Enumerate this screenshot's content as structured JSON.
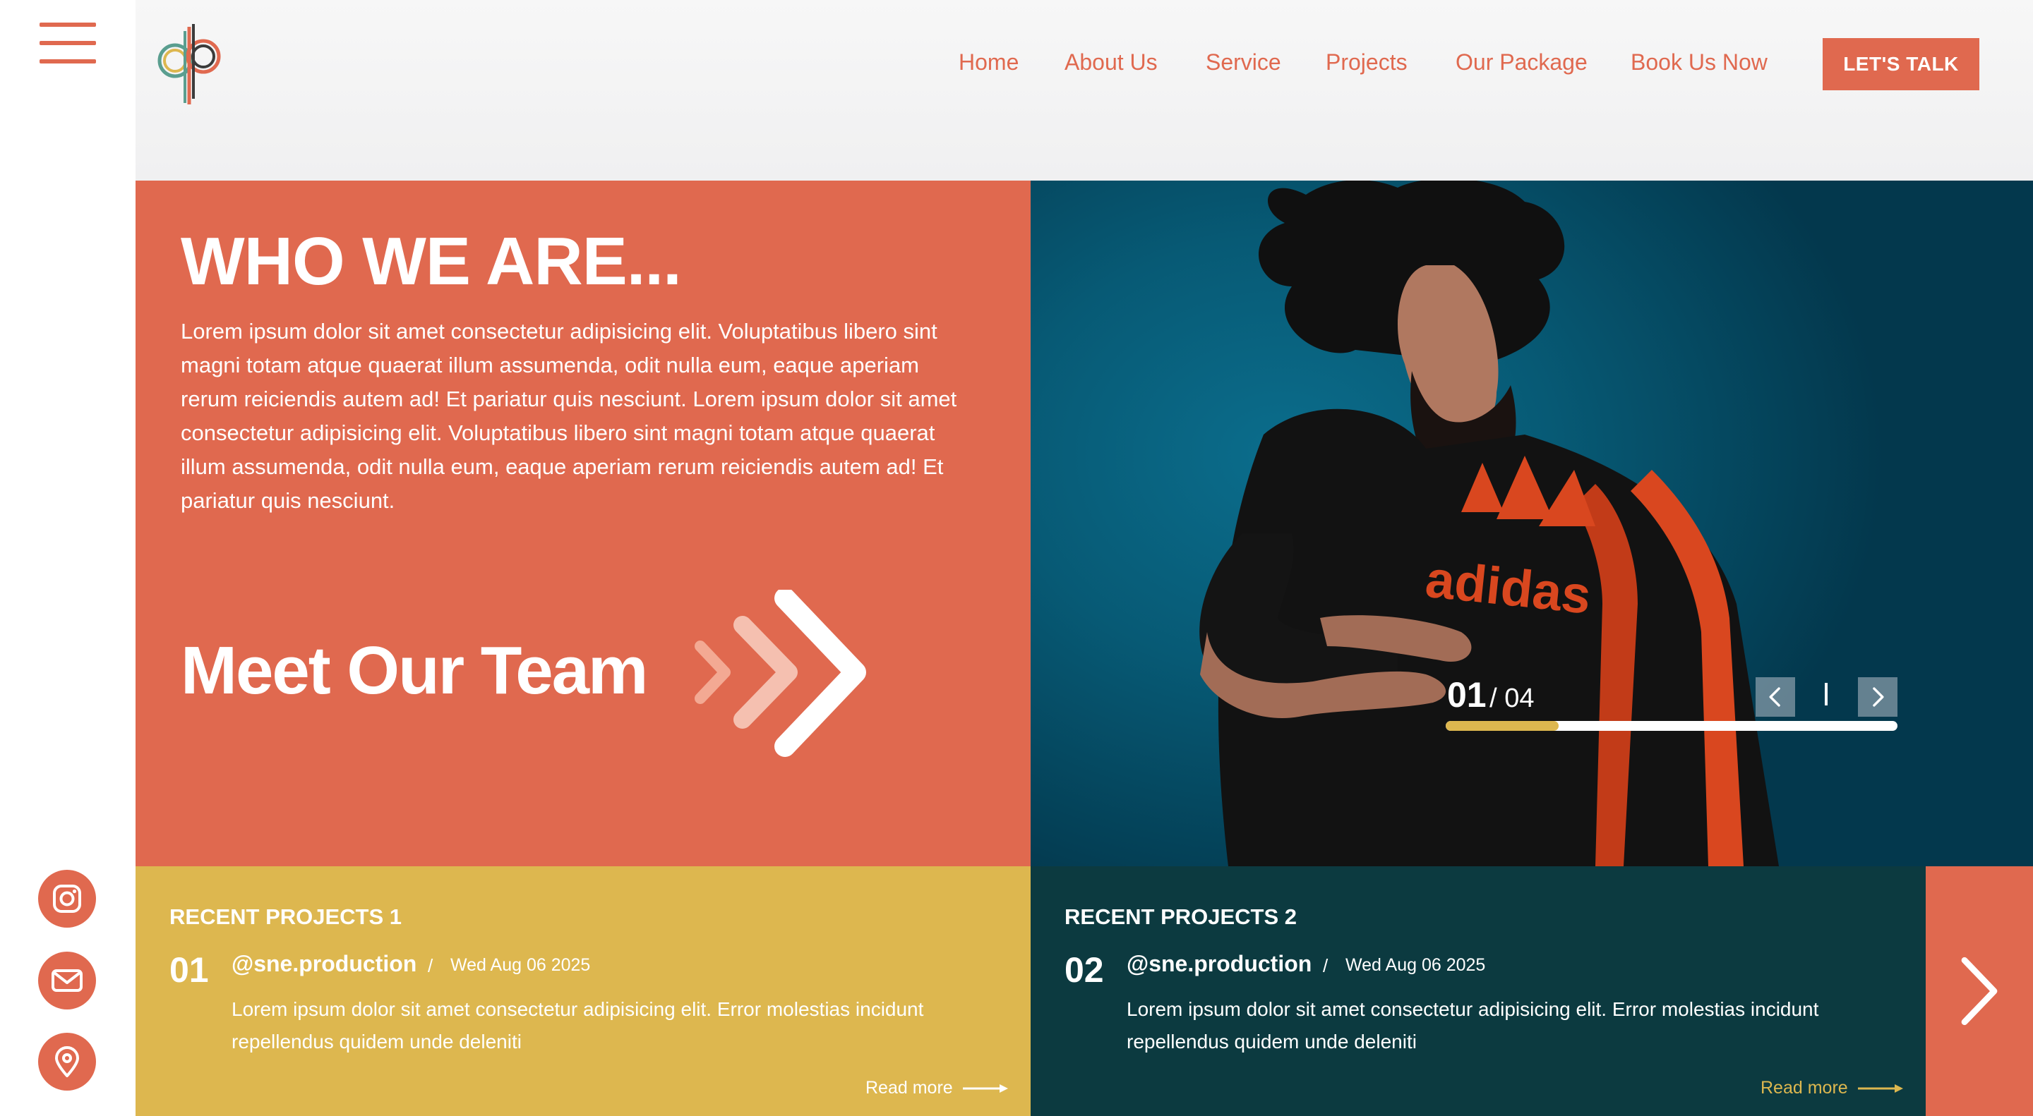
{
  "brand": {
    "accent": "#e0694f",
    "yellow": "#ddb74f",
    "teal": "#0c3a40"
  },
  "nav": {
    "items": [
      "Home",
      "About Us",
      "Service",
      "Projects",
      "Our Package",
      "Book Us Now"
    ],
    "cta": "LET'S TALK"
  },
  "about": {
    "title": "WHO WE ARE...",
    "body": "Lorem ipsum dolor sit amet consectetur adipisicing elit. Voluptatibus libero sint magni totam atque quaerat illum assumenda, odit nulla eum, eaque aperiam rerum reiciendis autem ad! Et pariatur quis nesciunt. Lorem ipsum dolor sit amet consectetur adipisicing elit. Voluptatibus libero sint magni totam atque quaerat illum assumenda, odit nulla eum, eaque aperiam rerum reiciendis autem ad! Et pariatur quis nesciunt.",
    "team_link": "Meet Our Team"
  },
  "slider": {
    "current": "01",
    "total": "/ 04",
    "progress": 0.25
  },
  "projects": [
    {
      "heading": "RECENT PROJECTS 1",
      "number": "01",
      "handle": "@sne.production",
      "separator": "/",
      "date": "Wed Aug 06 2025",
      "text": "Lorem ipsum dolor sit amet consectetur adipisicing elit. Error molestias incidunt repellendus quidem unde deleniti",
      "read_more": "Read more",
      "read_more_color": "#ffffff"
    },
    {
      "heading": "RECENT PROJECTS 2",
      "number": "02",
      "handle": "@sne.production",
      "separator": "/",
      "date": "Wed Aug 06 2025",
      "text": "Lorem ipsum dolor sit amet consectetur adipisicing elit. Error molestias incidunt repellendus quidem unde deleniti",
      "read_more": "Read more",
      "read_more_color": "#ddb74f"
    }
  ],
  "icons": {
    "menu": "hamburger-icon",
    "social": [
      "instagram-icon",
      "mail-icon",
      "location-pin-icon"
    ],
    "slider_prev": "chevron-left-icon",
    "slider_next": "chevron-right-icon",
    "projects_next": "chevron-right-icon"
  }
}
